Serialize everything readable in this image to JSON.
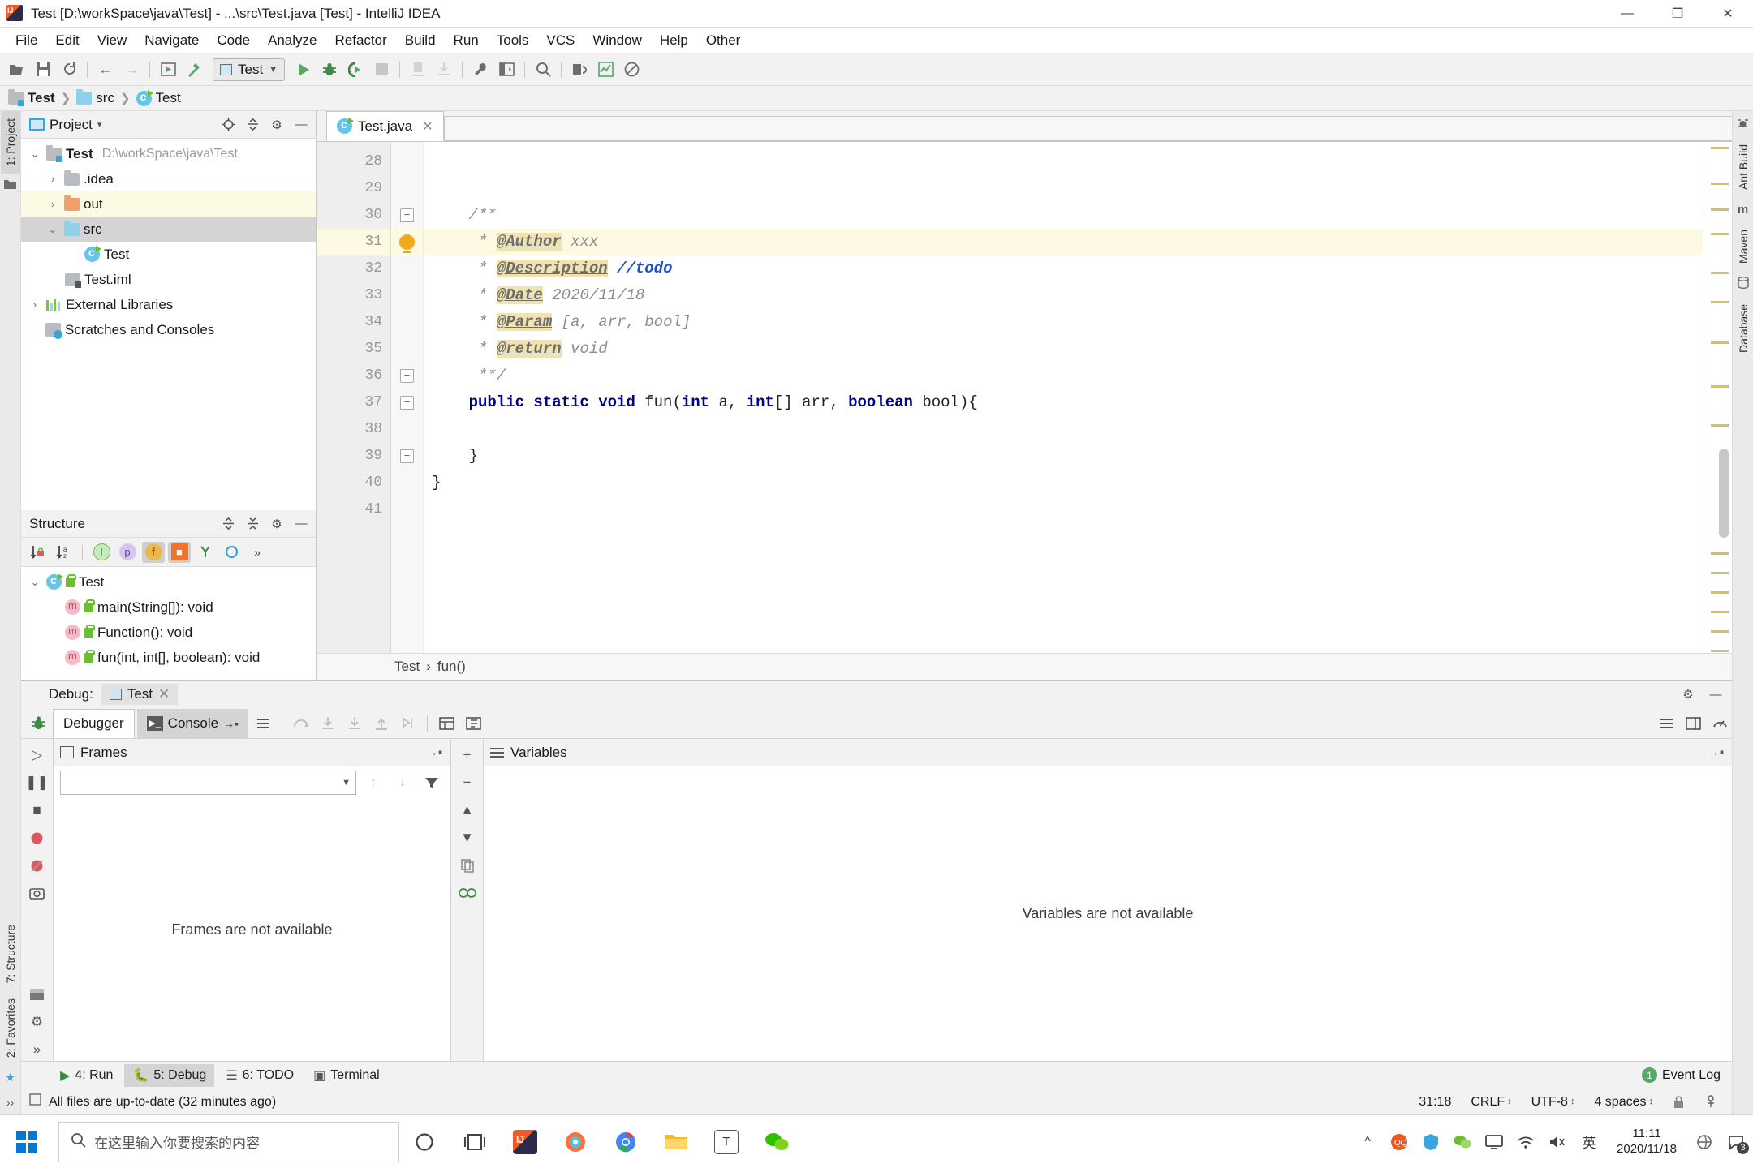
{
  "window": {
    "title": "Test [D:\\workSpace\\java\\Test] - ...\\src\\Test.java [Test] - IntelliJ IDEA",
    "minimize": "—",
    "maximize": "❐",
    "close": "✕"
  },
  "menu": [
    {
      "label": "File"
    },
    {
      "label": "Edit"
    },
    {
      "label": "View"
    },
    {
      "label": "Navigate"
    },
    {
      "label": "Code"
    },
    {
      "label": "Analyze"
    },
    {
      "label": "Refactor"
    },
    {
      "label": "Build"
    },
    {
      "label": "Run"
    },
    {
      "label": "Tools"
    },
    {
      "label": "VCS"
    },
    {
      "label": "Window"
    },
    {
      "label": "Help"
    },
    {
      "label": "Other"
    }
  ],
  "toolbar": {
    "run_config": "Test",
    "icons": [
      "open-folder-icon",
      "save-all-icon",
      "sync-icon",
      "back-arrow-icon",
      "forward-arrow-icon",
      "run-config-icon",
      "build-hammer-icon",
      "run-icon",
      "debug-icon",
      "run-coverage-icon",
      "stop-icon",
      "step-icon",
      "attach-icon",
      "settings-wrench-icon",
      "layout-icon",
      "search-icon",
      "find-replace-icon",
      "chart-icon",
      "no-entry-icon"
    ]
  },
  "breadcrumb": [
    {
      "label": "Test",
      "icon": "module-icon"
    },
    {
      "label": "src",
      "icon": "folder-icon"
    },
    {
      "label": "Test",
      "icon": "class-icon"
    }
  ],
  "left_stripe": [
    {
      "label": "1: Project",
      "icon": "project-icon",
      "selected": true
    }
  ],
  "left_stripe_bottom": [
    {
      "label": "7: Structure",
      "icon": "structure-icon"
    },
    {
      "label": "2: Favorites",
      "icon": "favorites-icon"
    }
  ],
  "right_stripe": [
    {
      "label": "Ant Build",
      "icon": "ant-icon"
    },
    {
      "label": "Maven",
      "icon": "maven-icon"
    },
    {
      "label": "Database",
      "icon": "database-icon"
    }
  ],
  "project_panel": {
    "title": "Project",
    "chevron": "▾",
    "tree": [
      {
        "indent": 1,
        "arrow": "⌄",
        "icon": "module-icon",
        "label": "Test",
        "bold": true,
        "path": "D:\\workSpace\\java\\Test",
        "state": "normal"
      },
      {
        "indent": 2,
        "arrow": "›",
        "icon": "folder-gray-icon",
        "label": ".idea",
        "bold": false,
        "path": "",
        "state": "normal"
      },
      {
        "indent": 2,
        "arrow": "›",
        "icon": "folder-orange-icon",
        "label": "out",
        "bold": false,
        "path": "",
        "state": "highlight"
      },
      {
        "indent": 2,
        "arrow": "⌄",
        "icon": "folder-icon",
        "label": "src",
        "bold": false,
        "path": "",
        "state": "selected"
      },
      {
        "indent": 3,
        "arrow": "",
        "icon": "class-icon",
        "label": "Test",
        "bold": false,
        "path": "",
        "state": "normal"
      },
      {
        "indent": 2,
        "arrow": "",
        "icon": "iml-icon",
        "label": "Test.iml",
        "bold": false,
        "path": "",
        "state": "normal"
      },
      {
        "indent": 1,
        "arrow": "›",
        "icon": "library-icon",
        "label": "External Libraries",
        "bold": false,
        "path": "",
        "state": "normal"
      },
      {
        "indent": 1,
        "arrow": "",
        "icon": "scratches-icon",
        "label": "Scratches and Consoles",
        "bold": false,
        "path": "",
        "state": "normal"
      }
    ]
  },
  "structure_panel": {
    "title": "Structure",
    "toolbar_icons": [
      "sort-by-visibility-icon",
      "sort-alphabetically-icon",
      "show-inherited-icon",
      "show-properties-icon",
      "show-fields-icon",
      "show-non-public-icon",
      "show-anonymous-icon",
      "expand-all-icon",
      "more-icon"
    ],
    "tree": [
      {
        "indent": 1,
        "arrow": "⌄",
        "icon": "class-icon",
        "label": "Test"
      },
      {
        "indent": 2,
        "arrow": "",
        "icon": "method-icon",
        "label": "main(String[]): void"
      },
      {
        "indent": 2,
        "arrow": "",
        "icon": "method-icon",
        "label": "Function(): void"
      },
      {
        "indent": 2,
        "arrow": "",
        "icon": "method-icon",
        "label": "fun(int, int[], boolean): void"
      }
    ]
  },
  "editor": {
    "tab": {
      "label": "Test.java",
      "close": "✕",
      "icon": "class-icon"
    },
    "lines": [
      {
        "num": "28",
        "fold": "",
        "bulb": false,
        "hl": false,
        "tokens": []
      },
      {
        "num": "29",
        "fold": "",
        "bulb": false,
        "hl": false,
        "tokens": []
      },
      {
        "num": "30",
        "fold": "tip",
        "bulb": false,
        "hl": false,
        "tokens": [
          {
            "t": "cmt",
            "s": "    /**"
          }
        ]
      },
      {
        "num": "31",
        "fold": "",
        "bulb": true,
        "hl": true,
        "tokens": [
          {
            "t": "cmt",
            "s": "     * "
          },
          {
            "t": "tag",
            "s": "@Author"
          },
          {
            "t": "cmt",
            "s": " xxx"
          }
        ]
      },
      {
        "num": "32",
        "fold": "",
        "bulb": false,
        "hl": false,
        "tokens": [
          {
            "t": "cmt",
            "s": "     * "
          },
          {
            "t": "tag",
            "s": "@Description"
          },
          {
            "t": "cmt",
            "s": " "
          },
          {
            "t": "todo",
            "s": "//todo"
          }
        ]
      },
      {
        "num": "33",
        "fold": "",
        "bulb": false,
        "hl": false,
        "tokens": [
          {
            "t": "cmt",
            "s": "     * "
          },
          {
            "t": "tag",
            "s": "@Date"
          },
          {
            "t": "cmt",
            "s": " 2020/11/18"
          }
        ]
      },
      {
        "num": "34",
        "fold": "",
        "bulb": false,
        "hl": false,
        "tokens": [
          {
            "t": "cmt",
            "s": "     * "
          },
          {
            "t": "tag",
            "s": "@Param"
          },
          {
            "t": "cmt",
            "s": " [a, arr, bool]"
          }
        ]
      },
      {
        "num": "35",
        "fold": "",
        "bulb": false,
        "hl": false,
        "tokens": [
          {
            "t": "cmt",
            "s": "     * "
          },
          {
            "t": "tag",
            "s": "@return"
          },
          {
            "t": "cmt",
            "s": " void"
          }
        ]
      },
      {
        "num": "36",
        "fold": "end",
        "bulb": false,
        "hl": false,
        "tokens": [
          {
            "t": "cmt",
            "s": "     **/"
          }
        ]
      },
      {
        "num": "37",
        "fold": "tip",
        "bulb": false,
        "hl": false,
        "tokens": [
          {
            "t": "kw",
            "s": "    public static void "
          },
          {
            "t": "pl",
            "s": "fun("
          },
          {
            "t": "kw",
            "s": "int"
          },
          {
            "t": "pl",
            "s": " a, "
          },
          {
            "t": "kw",
            "s": "int"
          },
          {
            "t": "pl",
            "s": "[] arr, "
          },
          {
            "t": "kw",
            "s": "boolean"
          },
          {
            "t": "pl",
            "s": " bool){"
          }
        ]
      },
      {
        "num": "38",
        "fold": "",
        "bulb": false,
        "hl": false,
        "tokens": []
      },
      {
        "num": "39",
        "fold": "end",
        "bulb": false,
        "hl": false,
        "tokens": [
          {
            "t": "pl",
            "s": "    }"
          }
        ]
      },
      {
        "num": "40",
        "fold": "",
        "bulb": false,
        "hl": false,
        "tokens": [
          {
            "t": "pl",
            "s": "}"
          }
        ]
      },
      {
        "num": "41",
        "fold": "",
        "bulb": false,
        "hl": false,
        "tokens": []
      }
    ],
    "breadcrumb": [
      {
        "label": "Test"
      },
      {
        "label": "fun()"
      }
    ],
    "breadcrumb_sep": "›"
  },
  "debug": {
    "label": "Debug:",
    "session_tab": "Test",
    "session_close": "✕",
    "tabs": [
      {
        "label": "Debugger",
        "active": true,
        "icon": "debugger-icon"
      },
      {
        "label": "Console",
        "active": false,
        "icon": "console-icon"
      }
    ],
    "toolbar_icons": [
      "show-execution-point-icon",
      "step-over-icon",
      "step-into-icon",
      "force-step-into-icon",
      "step-out-icon",
      "run-to-cursor-icon",
      "evaluate-expression-icon",
      "mute-breakpoints-icon"
    ],
    "frames": {
      "title": "Frames",
      "empty_message": "Frames are not available",
      "thread_selector": "",
      "icons": [
        "up-stack-icon",
        "down-stack-icon",
        "filter-icon",
        "collapse-icon"
      ]
    },
    "variables": {
      "title": "Variables",
      "empty_message": "Variables are not available",
      "rail_icons": [
        "add-watch-icon",
        "remove-watch-icon",
        "up-icon",
        "down-icon",
        "copy-icon",
        "inspect-icon"
      ]
    },
    "left_rail_icons": [
      "resume-icon",
      "pause-icon",
      "stop-icon",
      "breakpoints-icon",
      "mute-breakpoints-icon",
      "camera-icon",
      "layout-icon",
      "settings-icon",
      "more-icon"
    ]
  },
  "tool_windows": [
    {
      "label": "4: Run",
      "icon": "run-icon",
      "selected": false
    },
    {
      "label": "5: Debug",
      "icon": "debug-icon",
      "selected": true
    },
    {
      "label": "6: TODO",
      "icon": "todo-icon",
      "selected": false
    },
    {
      "label": "Terminal",
      "icon": "terminal-icon",
      "selected": false
    }
  ],
  "event_log": {
    "label": "Event Log",
    "count": "1"
  },
  "status_bar": {
    "message": "All files are up-to-date (32 minutes ago)",
    "caret": "31:18",
    "line_sep": "CRLF",
    "encoding": "UTF-8",
    "indent": "4 spaces",
    "stepper": "↕"
  },
  "taskbar": {
    "search_placeholder": "在这里输入你要搜索的内容",
    "apps": [
      {
        "name": "cortana-icon",
        "color": "#ffffff"
      },
      {
        "name": "task-view-icon",
        "color": "#ffffff"
      },
      {
        "name": "intellij-icon",
        "color": "#f05a28"
      },
      {
        "name": "firefox-icon",
        "color": "#ff7139"
      },
      {
        "name": "chrome-icon",
        "color": "#4285f4"
      },
      {
        "name": "explorer-icon",
        "color": "#f7b731"
      },
      {
        "name": "typora-icon",
        "color": "#ffffff"
      },
      {
        "name": "wechat-icon",
        "color": "#2dc100"
      }
    ],
    "tray": [
      "chevron-up-icon",
      "qq-icon",
      "security-icon",
      "wechat-small-icon",
      "monitor-icon",
      "network-icon",
      "volume-icon"
    ],
    "ime": "英",
    "time": "11:11",
    "date": "2020/11/18",
    "notify_count": "3"
  },
  "colors": {
    "accent": "#3aa5dc",
    "highlight_row": "#fdfae3",
    "selected_row": "#d4d4d4",
    "javadoc_tag_bg": "#f0e3b0",
    "keyword": "#00008f",
    "todo": "#1a50c8",
    "comment": "#8c8c8c",
    "green": "#59a869",
    "orange": "#f0a06a"
  }
}
